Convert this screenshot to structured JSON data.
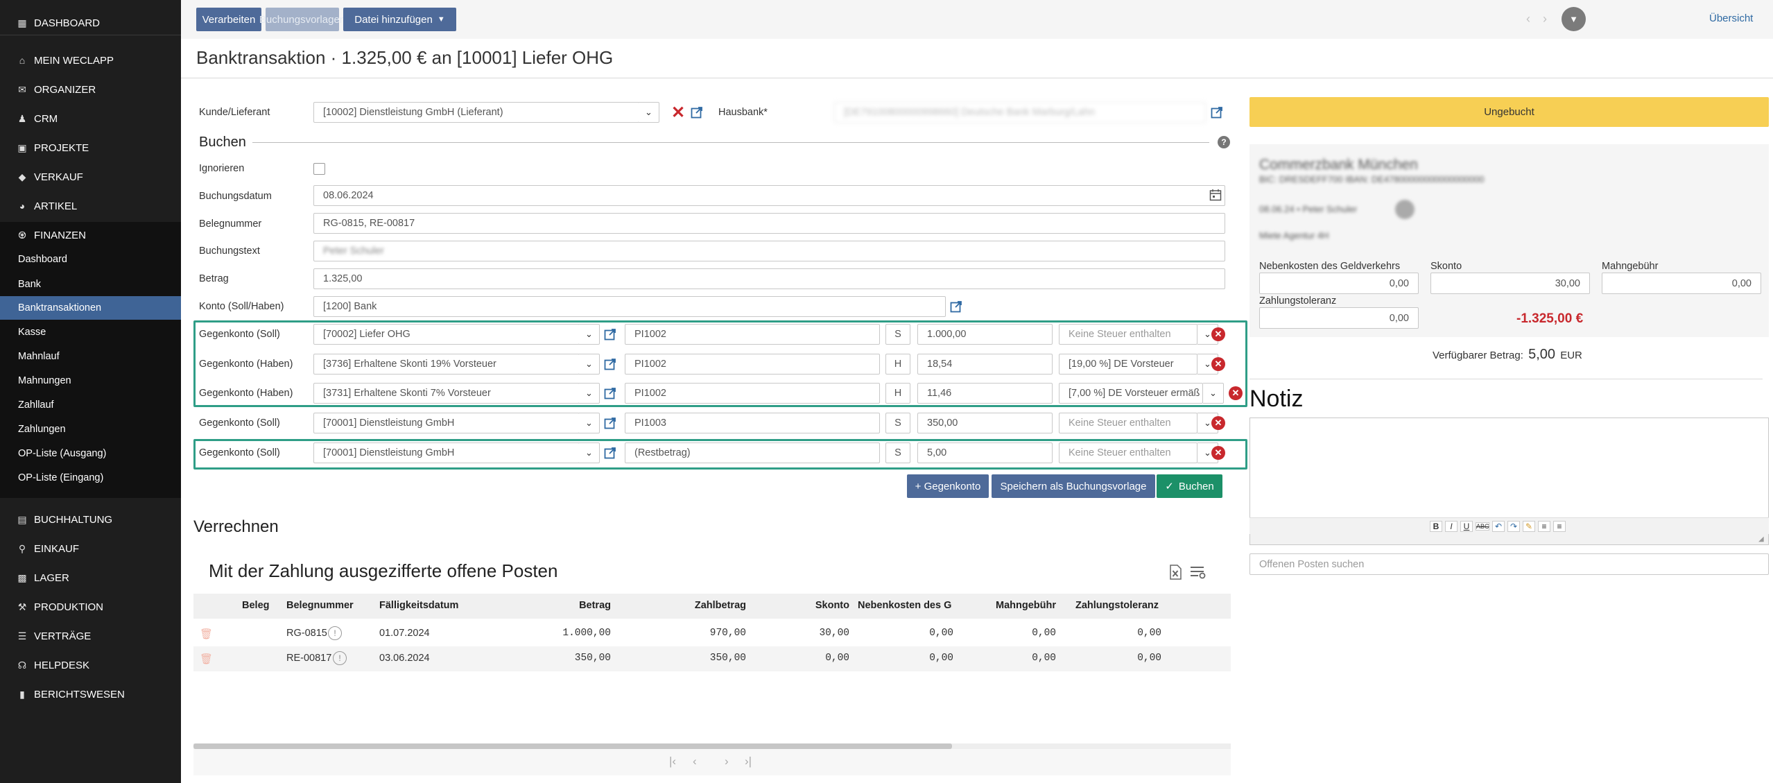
{
  "colors": {
    "accent": "#4e6a99",
    "green": "#1c9068",
    "warning": "#f7cf54",
    "danger": "#c8282d",
    "highlight_border": "#2f9e87",
    "sidebar_bg": "#1e1e1e",
    "sidebar_active": "#3f6496"
  },
  "sidebar": {
    "top": [
      {
        "label": "DASHBOARD",
        "icon": "dashboard-icon"
      },
      {
        "label": "MEIN WECLAPP",
        "icon": "home-icon"
      },
      {
        "label": "ORGANIZER",
        "icon": "mail-icon"
      },
      {
        "label": "CRM",
        "icon": "users-icon"
      },
      {
        "label": "PROJEKTE",
        "icon": "briefcase-icon"
      },
      {
        "label": "VERKAUF",
        "icon": "tag-icon"
      },
      {
        "label": "ARTIKEL",
        "icon": "gauge-icon"
      },
      {
        "label": "FINANZEN",
        "icon": "bank-icon"
      }
    ],
    "finanzen_sub": [
      "Dashboard",
      "Bank",
      "Banktransaktionen",
      "Kasse",
      "Mahnlauf",
      "Mahnungen",
      "Zahllauf",
      "Zahlungen",
      "OP-Liste (Ausgang)",
      "OP-Liste (Eingang)"
    ],
    "bottom": [
      {
        "label": "BUCHHALTUNG",
        "icon": "book-icon"
      },
      {
        "label": "EINKAUF",
        "icon": "cart-icon"
      },
      {
        "label": "LAGER",
        "icon": "box-icon"
      },
      {
        "label": "PRODUKTION",
        "icon": "wrench-icon"
      },
      {
        "label": "VERTRÄGE",
        "icon": "contract-icon"
      },
      {
        "label": "HELPDESK",
        "icon": "headset-icon"
      },
      {
        "label": "BERICHTSWESEN",
        "icon": "bar-chart-icon"
      }
    ]
  },
  "toolbar": {
    "verarbeiten": "Verarbeiten",
    "buchungsvorlagen": "Buchungsvorlagen",
    "datei": "Datei hinzufügen",
    "uebersicht": "Übersicht"
  },
  "page": {
    "title": "Banktransaktion · 1.325,00 € an [10001] Liefer OHG"
  },
  "form": {
    "kunde_label": "Kunde/Lieferant",
    "kunde_value": "[10002] Dienstleistung GmbH (Lieferant)",
    "hausbank_label": "Hausbank*",
    "hausbank_value": "[DE79100800000998660] Deutsche Bank Marburg/Lahn",
    "buchen_heading": "Buchen",
    "ignorieren_label": "Ignorieren",
    "buchungsdatum_label": "Buchungsdatum",
    "buchungsdatum_value": "08.06.2024",
    "belegnummer_label": "Belegnummer",
    "belegnummer_value": "RG-0815, RE-00817",
    "buchungstext_label": "Buchungstext",
    "buchungstext_value": "Peter Schuler",
    "betrag_label": "Betrag",
    "betrag_value": "1.325,00",
    "konto_label": "Konto (Soll/Haben)",
    "konto_value": "[1200] Bank"
  },
  "gegenkonten": [
    {
      "label": "Gegenkonto (Soll)",
      "konto": "[70002] Liefer OHG",
      "beleg": "PI1002",
      "sh": "S",
      "betrag": "1.000,00",
      "steuer": "Keine Steuer enthalten",
      "steuer_ph": true
    },
    {
      "label": "Gegenkonto (Haben)",
      "konto": "[3736] Erhaltene Skonti 19% Vorsteuer",
      "beleg": "PI1002",
      "sh": "H",
      "betrag": "18,54",
      "steuer": "[19,00 %] DE Vorsteuer",
      "steuer_ph": false
    },
    {
      "label": "Gegenkonto (Haben)",
      "konto": "[3731] Erhaltene Skonti 7% Vorsteuer",
      "beleg": "PI1002",
      "sh": "H",
      "betrag": "11,46",
      "steuer": "[7,00 %] DE Vorsteuer ermäß",
      "steuer_ph": false
    },
    {
      "label": "Gegenkonto (Soll)",
      "konto": "[70001] Dienstleistung GmbH",
      "beleg": "PI1003",
      "sh": "S",
      "betrag": "350,00",
      "steuer": "Keine Steuer enthalten",
      "steuer_ph": true
    },
    {
      "label": "Gegenkonto (Soll)",
      "konto": "[70001] Dienstleistung GmbH",
      "beleg": "(Restbetrag)",
      "sh": "S",
      "betrag": "5,00",
      "steuer": "Keine Steuer enthalten",
      "steuer_ph": true
    }
  ],
  "actions": {
    "gegenkonto": "+ Gegenkonto",
    "speichern": "Speichern als Buchungsvorlage",
    "buchen": "Buchen"
  },
  "verrechnen": {
    "heading": "Verrechnen",
    "subheading": "Mit der Zahlung ausgezifferte offene Posten",
    "columns": [
      "Beleg",
      "Belegnummer",
      "Fälligkeitsdatum",
      "Betrag",
      "Zahlbetrag",
      "Skonto",
      "Nebenkosten des G",
      "Mahngebühr",
      "Zahlungstoleranz"
    ],
    "rows": [
      {
        "belegnummer": "RG-0815",
        "faellig": "01.07.2024",
        "betrag": "1.000,00",
        "zahlbetrag": "970,00",
        "skonto": "30,00",
        "nebenkosten": "0,00",
        "mahngebuehr": "0,00",
        "toleranz": "0,00"
      },
      {
        "belegnummer": "RE-00817",
        "faellig": "03.06.2024",
        "betrag": "350,00",
        "zahlbetrag": "350,00",
        "skonto": "0,00",
        "nebenkosten": "0,00",
        "mahngebuehr": "0,00",
        "toleranz": "0,00"
      }
    ]
  },
  "right": {
    "status": "Ungebucht",
    "bank_name": "Commerzbank München",
    "bank_iban": "BIC: DRESDEFF700  IBAN: DE47800000000000000000",
    "bank_date_line": "08.06.24 • Peter Schuler",
    "bank_purpose": "Miete Agentur 4H",
    "nebenkosten_label": "Nebenkosten des Geldverkehrs",
    "nebenkosten_value": "0,00",
    "skonto_label": "Skonto",
    "skonto_value": "30,00",
    "mahngebuehr_label": "Mahngebühr",
    "mahngebuehr_value": "0,00",
    "toleranz_label": "Zahlungstoleranz",
    "toleranz_value": "0,00",
    "total": "-1.325,00 €",
    "verfuegbar_label": "Verfügbarer Betrag:",
    "verfuegbar_value": "5,00",
    "verfuegbar_currency": "EUR",
    "notiz_heading": "Notiz",
    "search_placeholder": "Offenen Posten suchen"
  }
}
